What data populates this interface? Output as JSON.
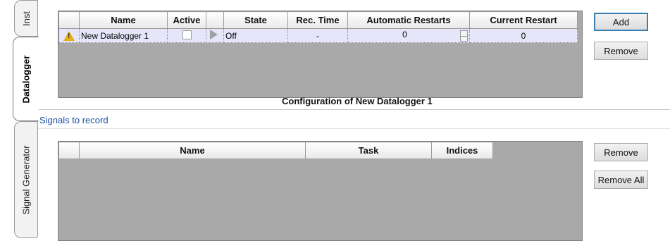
{
  "tabs": [
    {
      "label": "Inst",
      "active": false
    },
    {
      "label": "Datalogger",
      "active": true
    },
    {
      "label": "Signal Generator",
      "active": false
    }
  ],
  "datalogger_grid": {
    "columns": [
      "",
      "Name",
      "Active",
      "",
      "State",
      "Rec. Time",
      "Automatic Restarts",
      "Current Restart"
    ],
    "rows": [
      {
        "name": "New Datalogger 1",
        "active": false,
        "state": "Off",
        "rec_time": "-",
        "automatic_restarts": "0",
        "current_restart": "0"
      }
    ]
  },
  "buttons": {
    "add": "Add",
    "remove_top": "Remove",
    "remove_bottom": "Remove",
    "remove_all": "Remove All"
  },
  "section_title": "Configuration of New Datalogger 1",
  "group_label": "Signals to record",
  "signals_grid": {
    "columns": [
      "",
      "Name",
      "Task",
      "Indices"
    ]
  },
  "colors": {
    "grid_background": "#a9a9a9",
    "selected_row": "#e6e6fb",
    "link": "#1a4fa3"
  }
}
